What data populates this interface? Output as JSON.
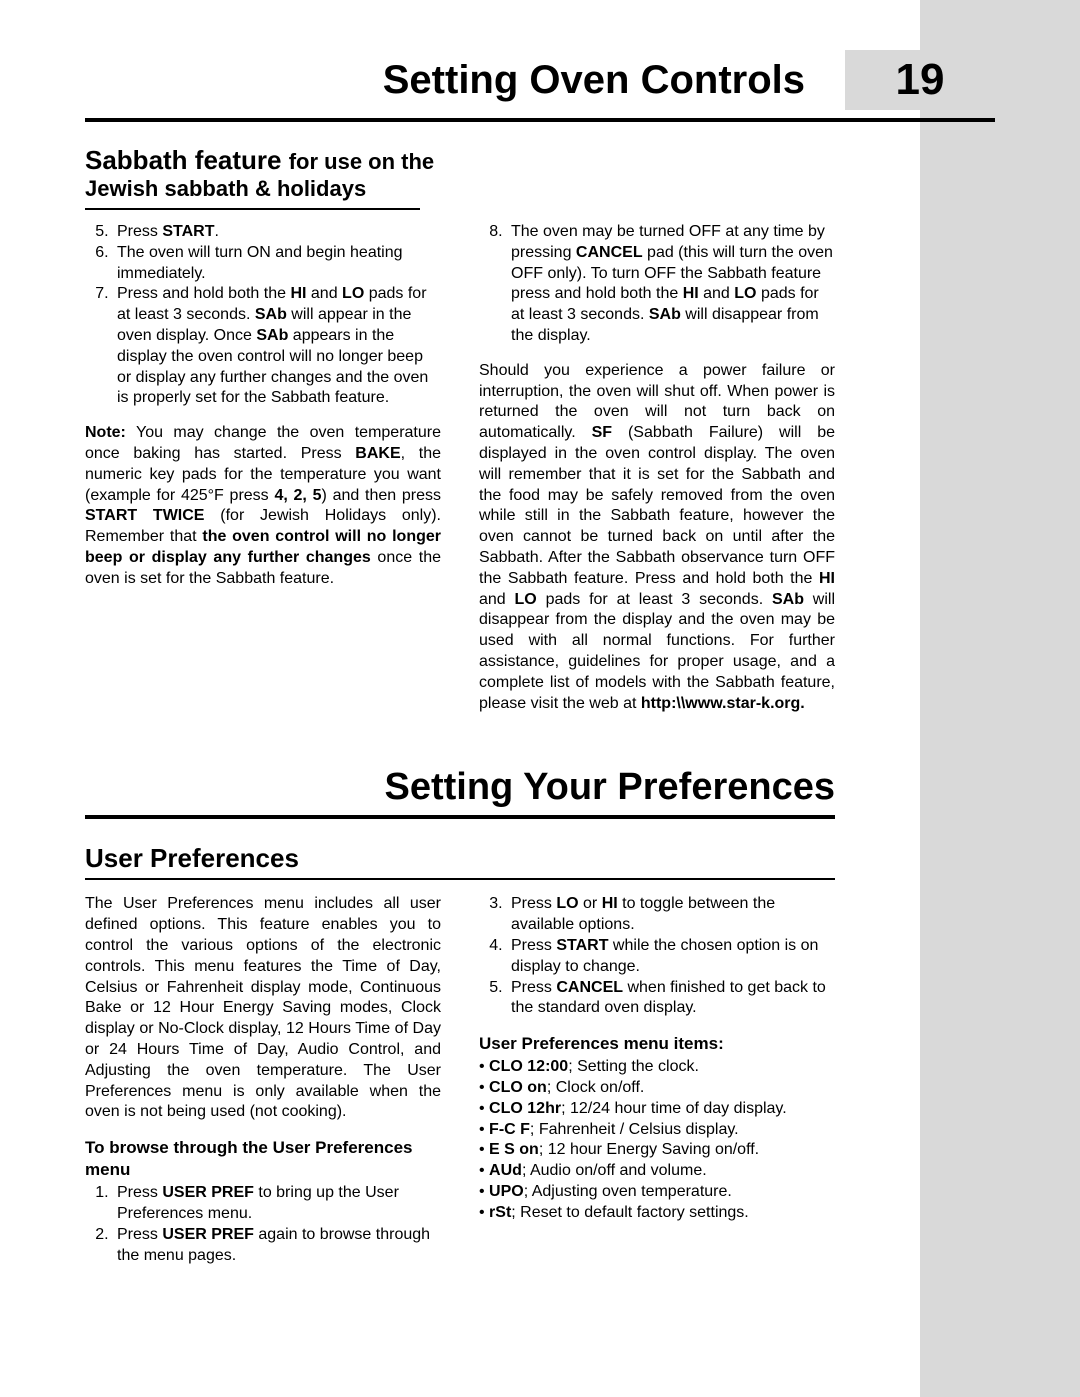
{
  "header": {
    "title": "Setting Oven Controls",
    "page_number": "19"
  },
  "sabbath": {
    "head_large": "Sabbath feature ",
    "head_small_1": "for use on the",
    "head_small_2": "Jewish sabbath & holidays",
    "left": {
      "step5_pre": "Press ",
      "step5_b": "START",
      "step5_post": ".",
      "step6": "The oven will turn ON and begin heating immediately.",
      "step7_pre": "Press and hold both the ",
      "step7_b1": "HI",
      "step7_mid1": " and ",
      "step7_b2": "LO",
      "step7_mid2": " pads for at least 3 seconds. ",
      "step7_b3": "SAb",
      "step7_mid3": " will appear in the oven display. Once ",
      "step7_b4": "SAb",
      "step7_post": " appears in the display the oven control will no longer beep or display any further changes and the oven is properly set for the Sabbath feature.",
      "note_label": "Note:",
      "note_1": " You may change the oven temperature once baking has started. Press ",
      "note_b1": "BAKE",
      "note_2": ", the numeric key pads for the temperature you want (example for 425°F press ",
      "note_b2": "4, 2, 5",
      "note_3": ") and then press ",
      "note_b3": "START TWICE",
      "note_4": " (for Jewish Holidays only). Remember that ",
      "note_b4": "the oven control will no longer beep or display any further changes",
      "note_5": " once the oven is set for the Sabbath feature."
    },
    "right": {
      "step8_pre": "The oven may be turned OFF at any time by pressing ",
      "step8_b1": "CANCEL",
      "step8_mid1": " pad (this will turn the oven OFF only). To turn OFF the Sabbath feature press and hold both the ",
      "step8_b2": "HI",
      "step8_mid2": " and ",
      "step8_b3": "LO",
      "step8_mid3": " pads for at least 3 seconds. ",
      "step8_b4": "SAb",
      "step8_post": " will disappear from the display.",
      "para2_1": "Should you experience a power failure or interruption, the oven will shut off. When power is returned the oven will not turn back on automatically. ",
      "para2_b1": "SF",
      "para2_2": " (Sabbath Failure) will be displayed in the oven control display. The oven will remember that it is set for the Sabbath and the food may be safely removed from the oven while still in the Sabbath feature, however the oven cannot be turned back on until after the Sabbath. After the Sabbath observance turn OFF the Sabbath feature. Press and hold both the ",
      "para2_b2": "HI",
      "para2_3": " and ",
      "para2_b3": "LO",
      "para2_4": " pads for at least 3 seconds. ",
      "para2_b4": "SAb",
      "para2_5": " will disappear from the display and the oven may be used with all normal functions. For further assistance, guidelines for proper usage, and a complete list of models with the Sabbath feature, please visit the web at ",
      "para2_b5": "http:\\\\www.star-k.org."
    }
  },
  "prefs": {
    "section_title": "Setting Your Preferences",
    "h3": "User Preferences",
    "left_para": "The User Preferences menu includes all user defined options. This feature enables you to control the various options of the electronic controls. This menu features the Time of Day, Celsius or Fahrenheit display mode, Continuous Bake or 12 Hour Energy Saving modes, Clock display or No-Clock display, 12 Hours Time of Day or 24 Hours Time of Day, Audio Control, and Adjusting the oven temperature. The User Preferences menu is only available when the oven is not being used (not cooking).",
    "left_h4": "To browse through the User Preferences menu",
    "browse": {
      "s1_pre": "Press ",
      "s1_b": "USER PREF",
      "s1_post": " to bring up the User Preferences menu.",
      "s2_pre": "Press ",
      "s2_b": "USER PREF",
      "s2_post": " again to browse through the menu pages."
    },
    "right_steps": {
      "s3_pre": "Press ",
      "s3_b1": "LO",
      "s3_mid": " or ",
      "s3_b2": "HI",
      "s3_post": " to toggle between the available options.",
      "s4_pre": "Press ",
      "s4_b": "START",
      "s4_post": " while the chosen option is on display to change.",
      "s5_pre": "Press ",
      "s5_b": "CANCEL",
      "s5_post": " when finished to get back to the standard oven display."
    },
    "menu_h4": "User Preferences menu items:",
    "menu": {
      "i1_b": "CLO 12:00",
      "i1_t": "; Setting the clock.",
      "i2_b": "CLO on",
      "i2_t": "; Clock on/off.",
      "i3_b": "CLO 12hr",
      "i3_t": "; 12/24 hour time of day display.",
      "i4_b": "F-C F",
      "i4_t": "; Fahrenheit / Celsius display.",
      "i5_b": "E S on",
      "i5_t": "; 12 hour Energy Saving on/off.",
      "i6_b": "AUd",
      "i6_t": "; Audio on/off and volume.",
      "i7_b": "UPO",
      "i7_t": "; Adjusting oven temperature.",
      "i8_b": "rSt",
      "i8_t": "; Reset to default factory settings."
    }
  }
}
